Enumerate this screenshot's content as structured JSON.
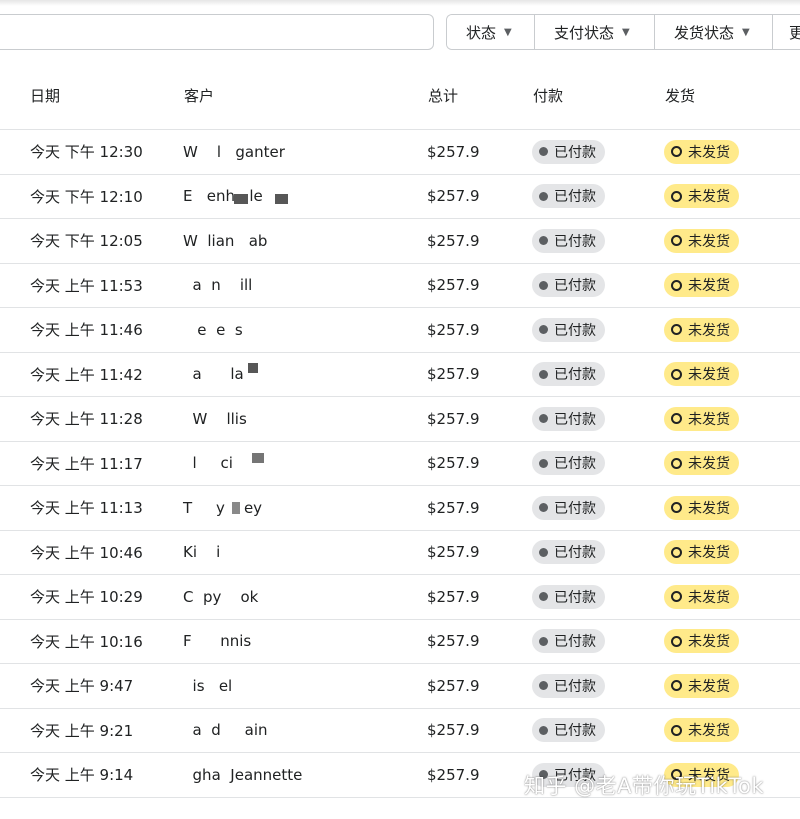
{
  "filters": {
    "status_label": "状态",
    "payment_status_label": "支付状态",
    "shipping_status_label": "发货状态",
    "more_label": "更"
  },
  "table": {
    "headers": {
      "date": "日期",
      "customer": "客户",
      "total": "总计",
      "payment": "付款",
      "shipping": "发货"
    },
    "rows": [
      {
        "date": "今天 下午 12:30",
        "customer": "W    l   ganter",
        "total": "$257.9",
        "payment": "已付款",
        "shipping": "未发货"
      },
      {
        "date": "今天 下午 12:10",
        "customer": "E   enh   le",
        "total": "$257.9",
        "payment": "已付款",
        "shipping": "未发货"
      },
      {
        "date": "今天 下午 12:05",
        "customer": "W  lian   ab",
        "total": "$257.9",
        "payment": "已付款",
        "shipping": "未发货"
      },
      {
        "date": "今天 上午 11:53",
        "customer": "  a  n    ill",
        "total": "$257.9",
        "payment": "已付款",
        "shipping": "未发货"
      },
      {
        "date": "今天 上午 11:46",
        "customer": "   e  e  s",
        "total": "$257.9",
        "payment": "已付款",
        "shipping": "未发货"
      },
      {
        "date": "今天 上午 11:42",
        "customer": "  a      la",
        "total": "$257.9",
        "payment": "已付款",
        "shipping": "未发货"
      },
      {
        "date": "今天 上午 11:28",
        "customer": "  W    llis",
        "total": "$257.9",
        "payment": "已付款",
        "shipping": "未发货"
      },
      {
        "date": "今天 上午 11:17",
        "customer": "  l     ci",
        "total": "$257.9",
        "payment": "已付款",
        "shipping": "未发货"
      },
      {
        "date": "今天 上午 11:13",
        "customer": "T     y    ey",
        "total": "$257.9",
        "payment": "已付款",
        "shipping": "未发货"
      },
      {
        "date": "今天 上午 10:46",
        "customer": "Ki    i",
        "total": "$257.9",
        "payment": "已付款",
        "shipping": "未发货"
      },
      {
        "date": "今天 上午 10:29",
        "customer": "C  py    ok",
        "total": "$257.9",
        "payment": "已付款",
        "shipping": "未发货"
      },
      {
        "date": "今天 上午 10:16",
        "customer": "F      nnis",
        "total": "$257.9",
        "payment": "已付款",
        "shipping": "未发货"
      },
      {
        "date": "今天 上午 9:47",
        "customer": "  is   el",
        "total": "$257.9",
        "payment": "已付款",
        "shipping": "未发货"
      },
      {
        "date": "今天 上午 9:21",
        "customer": "  a  d     ain",
        "total": "$257.9",
        "payment": "已付款",
        "shipping": "未发货"
      },
      {
        "date": "今天 上午 9:14",
        "customer": "  gha  Jeannette",
        "total": "$257.9",
        "payment": "已付款",
        "shipping": "未发货"
      }
    ]
  },
  "watermark": "知乎 @老A带你玩TikTok",
  "colors": {
    "paid_badge_bg": "#e4e5e7",
    "unshipped_badge_bg": "#ffea8a",
    "border": "#e1e3e5"
  }
}
